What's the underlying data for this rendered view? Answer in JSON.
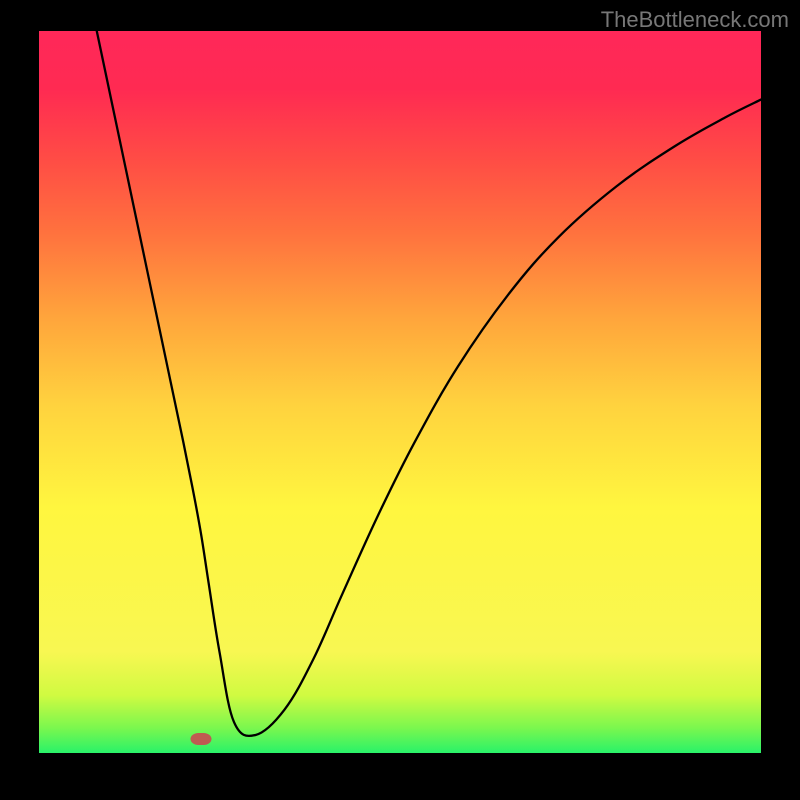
{
  "watermark": "TheBottleneck.com",
  "chart_data": {
    "type": "line",
    "title": "",
    "xlabel": "",
    "ylabel": "",
    "xlim": [
      0,
      100
    ],
    "ylim": [
      0,
      100
    ],
    "grid": false,
    "legend": false,
    "marker": {
      "x": 22.5,
      "y": 2
    },
    "series": [
      {
        "name": "curve",
        "x": [
          8,
          10,
          12,
          14,
          16,
          18,
          20,
          21.5,
          22.5,
          23.5,
          25,
          27,
          30,
          34,
          38,
          42,
          47,
          52,
          58,
          65,
          72,
          80,
          88,
          95,
          100
        ],
        "y": [
          100,
          90.5,
          81,
          71.5,
          62,
          52.5,
          43,
          35.5,
          30,
          23.5,
          14,
          4.3,
          2.5,
          6,
          13,
          22,
          33,
          43,
          53.5,
          63.5,
          71.5,
          78.5,
          84,
          88,
          90.5
        ]
      }
    ],
    "background_gradient": [
      {
        "stop": 0.0,
        "color": "#29f269"
      },
      {
        "stop": 0.035,
        "color": "#7bf74e"
      },
      {
        "stop": 0.08,
        "color": "#d0fa41"
      },
      {
        "stop": 0.14,
        "color": "#f8f752"
      },
      {
        "stop": 0.34,
        "color": "#fff63f"
      },
      {
        "stop": 0.48,
        "color": "#ffd33e"
      },
      {
        "stop": 0.6,
        "color": "#ffa63c"
      },
      {
        "stop": 0.72,
        "color": "#ff723e"
      },
      {
        "stop": 0.82,
        "color": "#ff4d45"
      },
      {
        "stop": 0.92,
        "color": "#ff2a52"
      },
      {
        "stop": 1.0,
        "color": "#ff2859"
      }
    ]
  }
}
